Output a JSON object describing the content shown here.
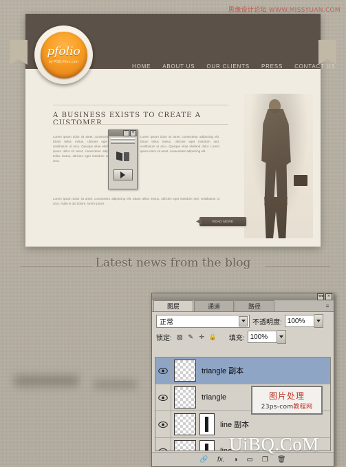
{
  "watermarks": {
    "top": "思缘设计论坛 WWW.MISSYUAN.COM",
    "top_cn": "思缘设计论坛",
    "top_en": "WWW.MISSYUAN.COM",
    "bottom": "UiBQ.CoM",
    "badge_line1": "图片处理",
    "badge_line2_a": "23ps-com",
    "badge_line2_b": "教程网"
  },
  "website": {
    "logo_text": "pfolio",
    "logo_sub": "by PSD.Files.com",
    "nav": [
      {
        "label": "HOME"
      },
      {
        "label": "ABOUT US"
      },
      {
        "label": "OUR CLIENTS"
      },
      {
        "label": "PRESS"
      },
      {
        "label": "CONTACT US"
      }
    ],
    "headline": "A BUSINESS EXISTS TO CREATE A CUSTOMER",
    "body_col1": "Lorem ipsum dolor sit amet, consectetur adipiscing elit. Etiam tellus metus, ultricies eget interdum sed, vestibulum ut arcu. Quisque vitae eleifend dolor. Lorem ipsum dolor sit amet, consectetur adipiscing elit. Etiam tellus metus, ultricies eget interdum sed, vestibulum ut arcu.",
    "body_col2": "Lorem ipsum dolor sit amet, consectetur adipiscing elit. Etiam tellus metus, ultricies eget interdum sed, vestibulum ut arcu. Quisque vitae eleifend dolor. Lorem ipsum dolor sit amet, consectetur adipiscing elit.",
    "body_col3": "Lorem ipsum dolor sit amet, consectetur adipiscing elit. Etiam tellus metus, ultricies eget interdum sed, vestibulum ut arcu. Nulla in dui dolore, lorem ipsum.",
    "readmore": "READ MORE"
  },
  "blog_heading": "Latest news from the blog",
  "mini_panel": {
    "close_label": "×",
    "min_label": "–",
    "play_icon": "play-icon"
  },
  "layers_panel": {
    "titlebar": {
      "collapse": "◄◄",
      "close": "×"
    },
    "tabs": [
      {
        "label": "图层",
        "active": true
      },
      {
        "label": "通道",
        "active": false
      },
      {
        "label": "路径",
        "active": false
      }
    ],
    "tab_menu_icon": "panel-menu-icon",
    "blend_mode": "正常",
    "opacity_label": "不透明度:",
    "opacity_value": "100%",
    "lock_label": "锁定:",
    "lock_icons": [
      "checker-lock-icon",
      "brush-lock-icon",
      "move-lock-icon",
      "all-lock-icon"
    ],
    "fill_label": "填充:",
    "fill_value": "100%",
    "layers": [
      {
        "name": "triangle 副本",
        "selected": true,
        "visible": true,
        "has_mask": false
      },
      {
        "name": "triangle",
        "selected": false,
        "visible": true,
        "has_mask": false
      },
      {
        "name": "line 副本",
        "selected": false,
        "visible": true,
        "has_mask": true
      },
      {
        "name": "line",
        "selected": false,
        "visible": true,
        "has_mask": true
      }
    ],
    "bottom_icons": [
      "link-icon",
      "fx-icon",
      "mask-icon",
      "folder-icon",
      "new-layer-icon",
      "trash-icon"
    ]
  }
}
